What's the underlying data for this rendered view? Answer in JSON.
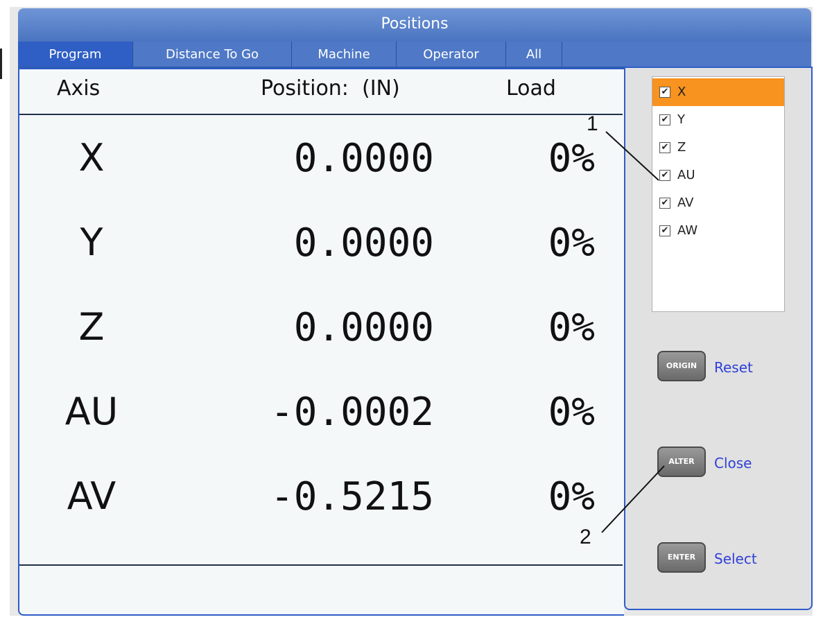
{
  "window": {
    "title": "Positions"
  },
  "tabs": [
    {
      "label": "Program",
      "active": true
    },
    {
      "label": "Distance To Go",
      "active": false
    },
    {
      "label": "Machine",
      "active": false
    },
    {
      "label": "Operator",
      "active": false
    },
    {
      "label": "All",
      "active": false
    }
  ],
  "table": {
    "headers": {
      "axis": "Axis",
      "position": "Position:  (IN)",
      "load": "Load"
    },
    "rows": [
      {
        "axis": "X",
        "position": "0.0000",
        "load": "0%"
      },
      {
        "axis": "Y",
        "position": "0.0000",
        "load": "0%"
      },
      {
        "axis": "Z",
        "position": "0.0000",
        "load": "0%"
      },
      {
        "axis": "AU",
        "position": "-0.0002",
        "load": "0%"
      },
      {
        "axis": "AV",
        "position": "-0.5215",
        "load": "0%"
      }
    ]
  },
  "axis_selector": {
    "items": [
      {
        "label": "X",
        "checked": true,
        "selected": true
      },
      {
        "label": "Y",
        "checked": true,
        "selected": false
      },
      {
        "label": "Z",
        "checked": true,
        "selected": false
      },
      {
        "label": "AU",
        "checked": true,
        "selected": false
      },
      {
        "label": "AV",
        "checked": true,
        "selected": false
      },
      {
        "label": "AW",
        "checked": true,
        "selected": false
      }
    ],
    "check_glyph": "✔"
  },
  "keys": [
    {
      "key": "ORIGIN",
      "label": "Reset"
    },
    {
      "key": "ALTER",
      "label": "Close"
    },
    {
      "key": "ENTER",
      "label": "Select"
    }
  ],
  "callouts": {
    "one": "1",
    "two": "2"
  },
  "colors": {
    "title_bar": "#4a74c0",
    "panel_border": "#2e5cc8",
    "selected_item": "#f7931e",
    "key_label": "#2f3fd8"
  }
}
